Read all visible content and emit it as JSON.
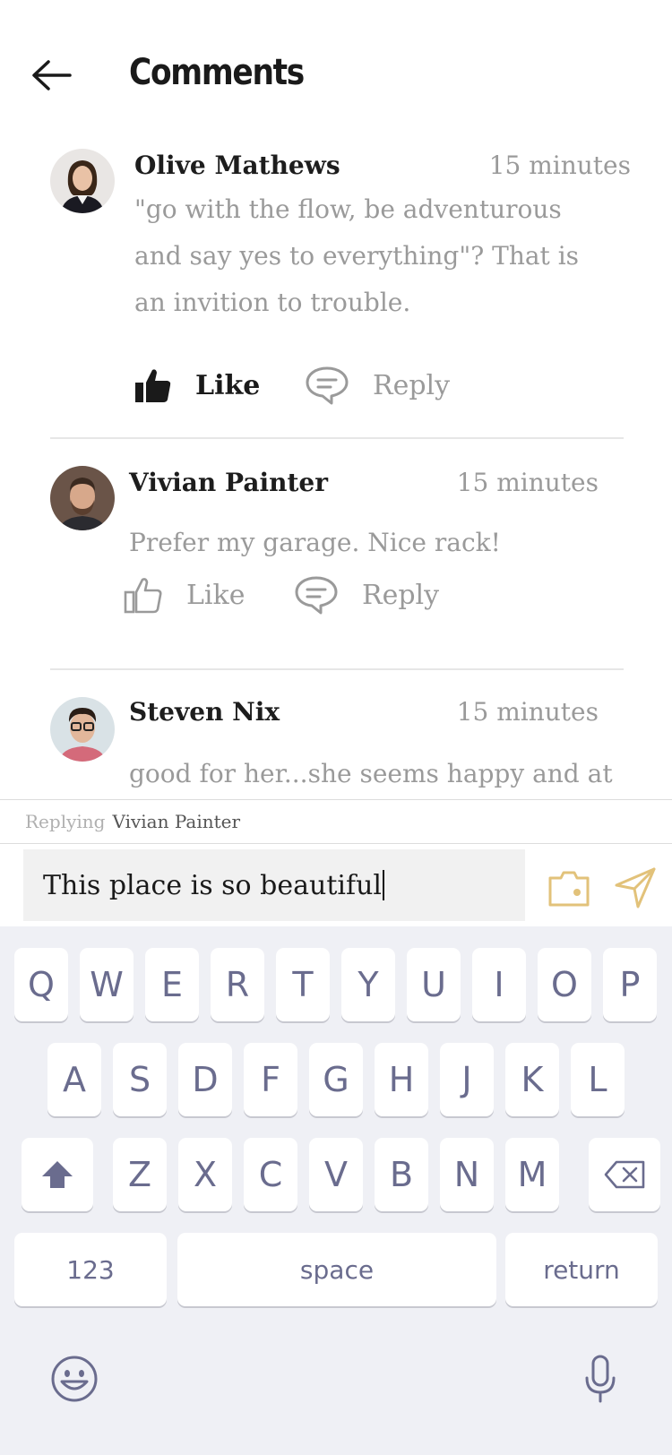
{
  "header": {
    "title": "Comments",
    "back_icon": "arrow-left-icon"
  },
  "comments": [
    {
      "name": "Olive Mathews",
      "time": "15 minutes",
      "text": "\"go with the flow, be adventurous and say yes to everything\"?  That is an invition to trouble.",
      "like_label": "Like",
      "like_active": true,
      "reply_label": "Reply"
    },
    {
      "name": "Vivian Painter",
      "time": "15 minutes",
      "text": "Prefer my garage. Nice rack!",
      "like_label": "Like",
      "like_active": false,
      "reply_label": "Reply"
    },
    {
      "name": "Steven Nix",
      "time": "15 minutes",
      "text": "good for her...she seems happy and at"
    }
  ],
  "replying": {
    "label": "Replying",
    "name": "Vivian Painter"
  },
  "composer": {
    "value": "This place is so beautiful",
    "camera_icon": "camera-icon",
    "send_icon": "send-icon",
    "accent": "#e2c27a"
  },
  "keyboard": {
    "row1": [
      "Q",
      "W",
      "E",
      "R",
      "T",
      "Y",
      "U",
      "I",
      "O",
      "P"
    ],
    "row2": [
      "A",
      "S",
      "D",
      "F",
      "G",
      "H",
      "J",
      "K",
      "L"
    ],
    "row3": [
      "Z",
      "X",
      "C",
      "V",
      "B",
      "N",
      "M"
    ],
    "numbers_label": "123",
    "space_label": "space",
    "return_label": "return"
  }
}
